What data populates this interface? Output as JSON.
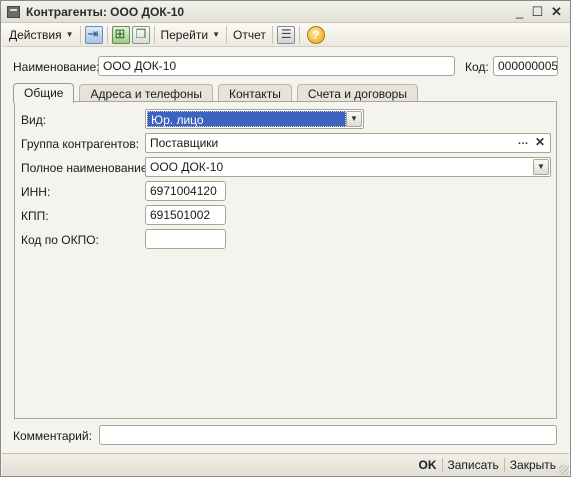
{
  "window": {
    "title": "Контрагенты: ООО ДОК-10",
    "minimize_glyph": "_",
    "maximize_glyph": "☐",
    "close_glyph": "✕"
  },
  "toolbar": {
    "actions_label": "Действия",
    "goto_label": "Перейти",
    "report_label": "Отчет",
    "help_glyph": "?",
    "icons": [
      "move-to-group-icon",
      "structure-icon",
      "copy-icon",
      "list-icon",
      "help-icon"
    ]
  },
  "header": {
    "name_label": "Наименование:",
    "name_value": "ООО ДОК-10",
    "code_label": "Код:",
    "code_value": "000000005"
  },
  "tabs": [
    {
      "label": "Общие",
      "active": true
    },
    {
      "label": "Адреса и телефоны",
      "active": false
    },
    {
      "label": "Контакты",
      "active": false
    },
    {
      "label": "Счета и договоры",
      "active": false
    }
  ],
  "general": {
    "type_label": "Вид:",
    "type_value": "Юр. лицо",
    "group_label": "Группа контрагентов:",
    "group_value": "Поставщики",
    "fullname_label": "Полное наименование:",
    "fullname_value": "ООО ДОК-10",
    "inn_label": "ИНН:",
    "inn_value": "6971004120",
    "kpp_label": "КПП:",
    "kpp_value": "691501002",
    "okpo_label": "Код по ОКПО:",
    "okpo_value": ""
  },
  "comment": {
    "label": "Комментарий:",
    "value": ""
  },
  "footer": {
    "ok_label": "OK",
    "save_label": "Записать",
    "close_label": "Закрыть"
  },
  "colors": {
    "selection": "#3d63c0",
    "window_bg": "#f4f3ee"
  }
}
